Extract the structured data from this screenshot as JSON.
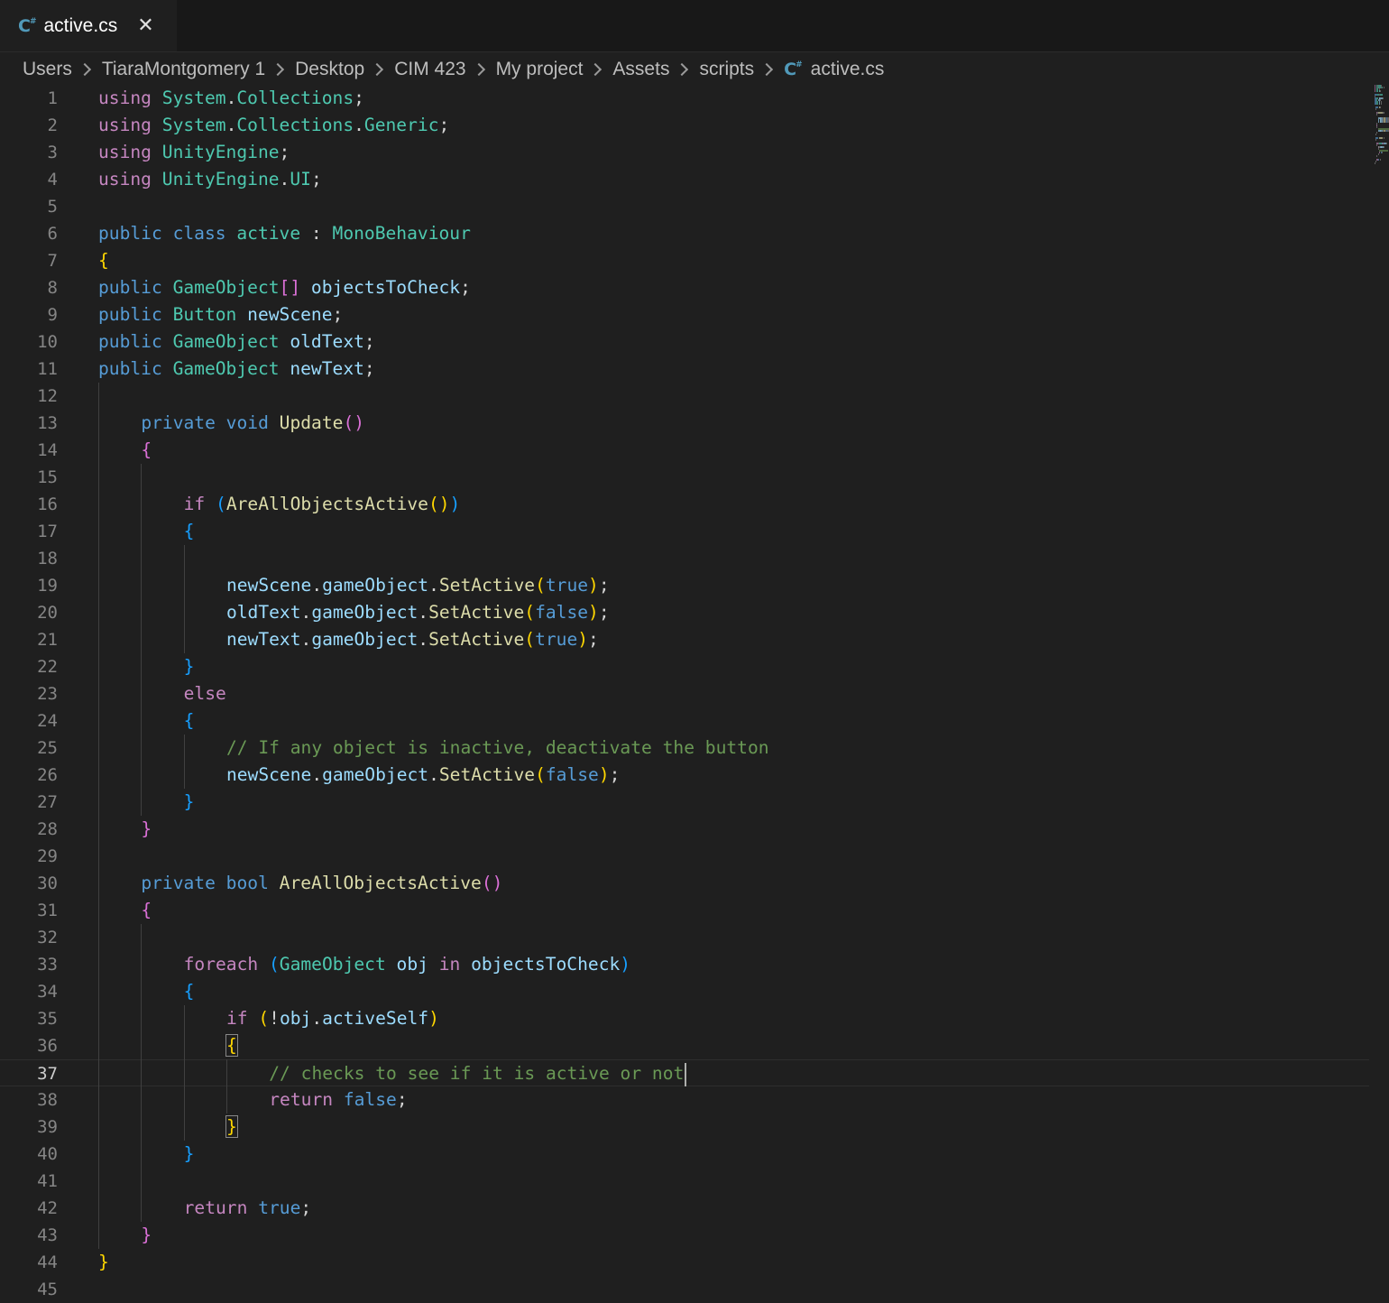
{
  "tab": {
    "label": "active.cs",
    "icon": "csharp-file-icon"
  },
  "breadcrumb": [
    "Users",
    "TiaraMontgomery 1",
    "Desktop",
    "CIM 423",
    "My project",
    "Assets",
    "scripts",
    "active.cs"
  ],
  "editor": {
    "current_line": 37,
    "lines": [
      {
        "n": "1",
        "indent": 0,
        "t": [
          [
            "kw",
            "using"
          ],
          [
            "",
            ""
          ],
          [
            "ty",
            " System"
          ],
          [
            "",
            "."
          ],
          [
            "ty",
            "Collections"
          ],
          [
            "",
            ";"
          ]
        ]
      },
      {
        "n": "2",
        "indent": 0,
        "t": [
          [
            "kw",
            "using"
          ],
          [
            "ty",
            " System"
          ],
          [
            "",
            "."
          ],
          [
            "ty",
            "Collections"
          ],
          [
            "",
            "."
          ],
          [
            "ty",
            "Generic"
          ],
          [
            "",
            ";"
          ]
        ]
      },
      {
        "n": "3",
        "indent": 0,
        "t": [
          [
            "kw",
            "using"
          ],
          [
            "ty",
            " UnityEngine"
          ],
          [
            "",
            ";"
          ]
        ]
      },
      {
        "n": "4",
        "indent": 0,
        "t": [
          [
            "kw",
            "using"
          ],
          [
            "ty",
            " UnityEngine"
          ],
          [
            "",
            "."
          ],
          [
            "ty",
            "UI"
          ],
          [
            "",
            ";"
          ]
        ]
      },
      {
        "n": "5",
        "indent": 0,
        "t": []
      },
      {
        "n": "6",
        "indent": 0,
        "t": [
          [
            "kb",
            "public"
          ],
          [
            "kb",
            " class"
          ],
          [
            "ty",
            " active"
          ],
          [
            "",
            " : "
          ],
          [
            "ty",
            "MonoBehaviour"
          ]
        ]
      },
      {
        "n": "7",
        "indent": 0,
        "t": [
          [
            "b1",
            "{"
          ]
        ]
      },
      {
        "n": "8",
        "indent": 0,
        "t": [
          [
            "kb",
            "public"
          ],
          [
            "ty",
            " GameObject"
          ],
          [
            "b2",
            "[]"
          ],
          [
            "va",
            " objectsToCheck"
          ],
          [
            "",
            ";"
          ]
        ]
      },
      {
        "n": "9",
        "indent": 0,
        "t": [
          [
            "kb",
            "public"
          ],
          [
            "ty",
            " Button"
          ],
          [
            "va",
            " newScene"
          ],
          [
            "",
            ";"
          ]
        ]
      },
      {
        "n": "10",
        "indent": 0,
        "t": [
          [
            "kb",
            "public"
          ],
          [
            "ty",
            " GameObject"
          ],
          [
            "va",
            " oldText"
          ],
          [
            "",
            ";"
          ]
        ]
      },
      {
        "n": "11",
        "indent": 0,
        "t": [
          [
            "kb",
            "public"
          ],
          [
            "ty",
            " GameObject"
          ],
          [
            "va",
            " newText"
          ],
          [
            "",
            ";"
          ]
        ]
      },
      {
        "n": "12",
        "indent": 0,
        "t": []
      },
      {
        "n": "13",
        "indent": 1,
        "t": [
          [
            "kb",
            "private"
          ],
          [
            "kb",
            " void"
          ],
          [
            "fn",
            " Update"
          ],
          [
            "b2",
            "()"
          ]
        ]
      },
      {
        "n": "14",
        "indent": 1,
        "t": [
          [
            "b2",
            "{"
          ]
        ]
      },
      {
        "n": "15",
        "indent": 0,
        "t": []
      },
      {
        "n": "16",
        "indent": 2,
        "t": [
          [
            "kw",
            "if"
          ],
          [
            "b3",
            " ("
          ],
          [
            "fn",
            "AreAllObjectsActive"
          ],
          [
            "b1",
            "()"
          ],
          [
            "b3",
            ")"
          ]
        ]
      },
      {
        "n": "17",
        "indent": 2,
        "t": [
          [
            "b3",
            "{"
          ]
        ]
      },
      {
        "n": "18",
        "indent": 0,
        "t": []
      },
      {
        "n": "19",
        "indent": 3,
        "t": [
          [
            "va",
            "newScene"
          ],
          [
            "",
            "."
          ],
          [
            "va",
            "gameObject"
          ],
          [
            "",
            "."
          ],
          [
            "fn",
            "SetActive"
          ],
          [
            "b1",
            "("
          ],
          [
            "kb",
            "true"
          ],
          [
            "b1",
            ")"
          ],
          [
            "",
            ";"
          ]
        ]
      },
      {
        "n": "20",
        "indent": 3,
        "t": [
          [
            "va",
            "oldText"
          ],
          [
            "",
            "."
          ],
          [
            "va",
            "gameObject"
          ],
          [
            "",
            "."
          ],
          [
            "fn",
            "SetActive"
          ],
          [
            "b1",
            "("
          ],
          [
            "kb",
            "false"
          ],
          [
            "b1",
            ")"
          ],
          [
            "",
            ";"
          ]
        ]
      },
      {
        "n": "21",
        "indent": 3,
        "t": [
          [
            "va",
            "newText"
          ],
          [
            "",
            "."
          ],
          [
            "va",
            "gameObject"
          ],
          [
            "",
            "."
          ],
          [
            "fn",
            "SetActive"
          ],
          [
            "b1",
            "("
          ],
          [
            "kb",
            "true"
          ],
          [
            "b1",
            ")"
          ],
          [
            "",
            ";"
          ]
        ]
      },
      {
        "n": "22",
        "indent": 2,
        "t": [
          [
            "b3",
            "}"
          ]
        ]
      },
      {
        "n": "23",
        "indent": 2,
        "t": [
          [
            "kw",
            "else"
          ]
        ]
      },
      {
        "n": "24",
        "indent": 2,
        "t": [
          [
            "b3",
            "{"
          ]
        ]
      },
      {
        "n": "25",
        "indent": 3,
        "t": [
          [
            "cm",
            "// If any object is inactive, deactivate the button"
          ]
        ]
      },
      {
        "n": "26",
        "indent": 3,
        "t": [
          [
            "va",
            "newScene"
          ],
          [
            "",
            "."
          ],
          [
            "va",
            "gameObject"
          ],
          [
            "",
            "."
          ],
          [
            "fn",
            "SetActive"
          ],
          [
            "b1",
            "("
          ],
          [
            "kb",
            "false"
          ],
          [
            "b1",
            ")"
          ],
          [
            "",
            ";"
          ]
        ]
      },
      {
        "n": "27",
        "indent": 2,
        "t": [
          [
            "b3",
            "}"
          ]
        ]
      },
      {
        "n": "28",
        "indent": 1,
        "t": [
          [
            "b2",
            "}"
          ]
        ]
      },
      {
        "n": "29",
        "indent": 0,
        "t": []
      },
      {
        "n": "30",
        "indent": 1,
        "t": [
          [
            "kb",
            "private"
          ],
          [
            "kb",
            " bool"
          ],
          [
            "fn",
            " AreAllObjectsActive"
          ],
          [
            "b2",
            "()"
          ]
        ]
      },
      {
        "n": "31",
        "indent": 1,
        "t": [
          [
            "b2",
            "{"
          ]
        ]
      },
      {
        "n": "32",
        "indent": 0,
        "t": []
      },
      {
        "n": "33",
        "indent": 2,
        "t": [
          [
            "kw",
            "foreach"
          ],
          [
            "b3",
            " ("
          ],
          [
            "ty",
            "GameObject"
          ],
          [
            "va",
            " obj"
          ],
          [
            "kw",
            " in"
          ],
          [
            "va",
            " objectsToCheck"
          ],
          [
            "b3",
            ")"
          ]
        ]
      },
      {
        "n": "34",
        "indent": 2,
        "t": [
          [
            "b3",
            "{"
          ]
        ]
      },
      {
        "n": "35",
        "indent": 3,
        "t": [
          [
            "kw",
            "if"
          ],
          [
            "b1",
            " ("
          ],
          [
            "",
            "!"
          ],
          [
            "va",
            "obj"
          ],
          [
            "",
            "."
          ],
          [
            "va",
            "activeSelf"
          ],
          [
            "b1",
            ")"
          ]
        ]
      },
      {
        "n": "36",
        "indent": 3,
        "t": [
          [
            "b1 bm",
            "{"
          ]
        ]
      },
      {
        "n": "37",
        "indent": 4,
        "t": [
          [
            "cm",
            "// checks to see if it is active or not"
          ]
        ],
        "cursor": true
      },
      {
        "n": "38",
        "indent": 4,
        "t": [
          [
            "kw",
            "return"
          ],
          [
            "kb",
            " false"
          ],
          [
            "",
            ";"
          ]
        ]
      },
      {
        "n": "39",
        "indent": 3,
        "t": [
          [
            "b1 bm",
            "}"
          ]
        ]
      },
      {
        "n": "40",
        "indent": 2,
        "t": [
          [
            "b3",
            "}"
          ]
        ]
      },
      {
        "n": "41",
        "indent": 0,
        "t": []
      },
      {
        "n": "42",
        "indent": 2,
        "t": [
          [
            "kw",
            "return"
          ],
          [
            "kb",
            " true"
          ],
          [
            "",
            ";"
          ]
        ]
      },
      {
        "n": "43",
        "indent": 1,
        "t": [
          [
            "b2",
            "}"
          ]
        ]
      },
      {
        "n": "44",
        "indent": 0,
        "t": [
          [
            "b1",
            "}"
          ]
        ]
      },
      {
        "n": "45",
        "indent": 0,
        "t": []
      }
    ]
  },
  "colors": {
    "background": "#1f1f1f",
    "keyword_control": "#c586c0",
    "keyword": "#569cd6",
    "type": "#4ec9b0",
    "function": "#dcdcaa",
    "variable": "#9cdcfe",
    "comment": "#6a9955"
  }
}
